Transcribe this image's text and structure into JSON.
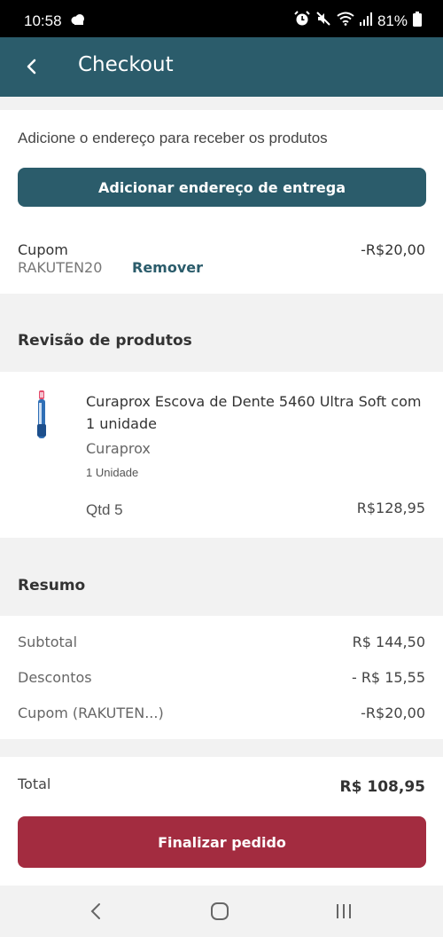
{
  "status_bar": {
    "time": "10:58",
    "battery": "81%"
  },
  "app_bar": {
    "title": "Checkout"
  },
  "address": {
    "prompt": "Adicione o endereço para receber os produtos",
    "button_label": "Adicionar endereço de entrega"
  },
  "coupon": {
    "label": "Cupom",
    "code": "RAKUTEN20",
    "remove_label": "Remover",
    "value": "-R$20,00"
  },
  "products_section": {
    "title": "Revisão de produtos",
    "items": [
      {
        "name": "Curaprox Escova de Dente 5460 Ultra Soft com 1 unidade",
        "brand": "Curaprox",
        "unit": "1 Unidade",
        "quantity": "Qtd 5",
        "price": "R$128,95"
      }
    ]
  },
  "summary": {
    "title": "Resumo",
    "rows": [
      {
        "label": "Subtotal",
        "value": "R$ 144,50"
      },
      {
        "label": "Descontos",
        "value": "- R$ 15,55"
      },
      {
        "label": "Cupom (RAKUTEN...)",
        "value": "-R$20,00"
      }
    ],
    "total_label": "Total",
    "total_value": "R$ 108,95",
    "finish_button_label": "Finalizar pedido"
  },
  "colors": {
    "primary": "#2b5c6b",
    "finish": "#a32c40",
    "background": "#f2f2f2"
  },
  "icons": [
    "cloud-icon",
    "alarm-icon",
    "mute-icon",
    "wifi-icon",
    "signal-icon",
    "battery-icon",
    "back-arrow-icon",
    "toothbrush-image",
    "nav-back-icon",
    "nav-home-icon",
    "nav-recents-icon"
  ]
}
